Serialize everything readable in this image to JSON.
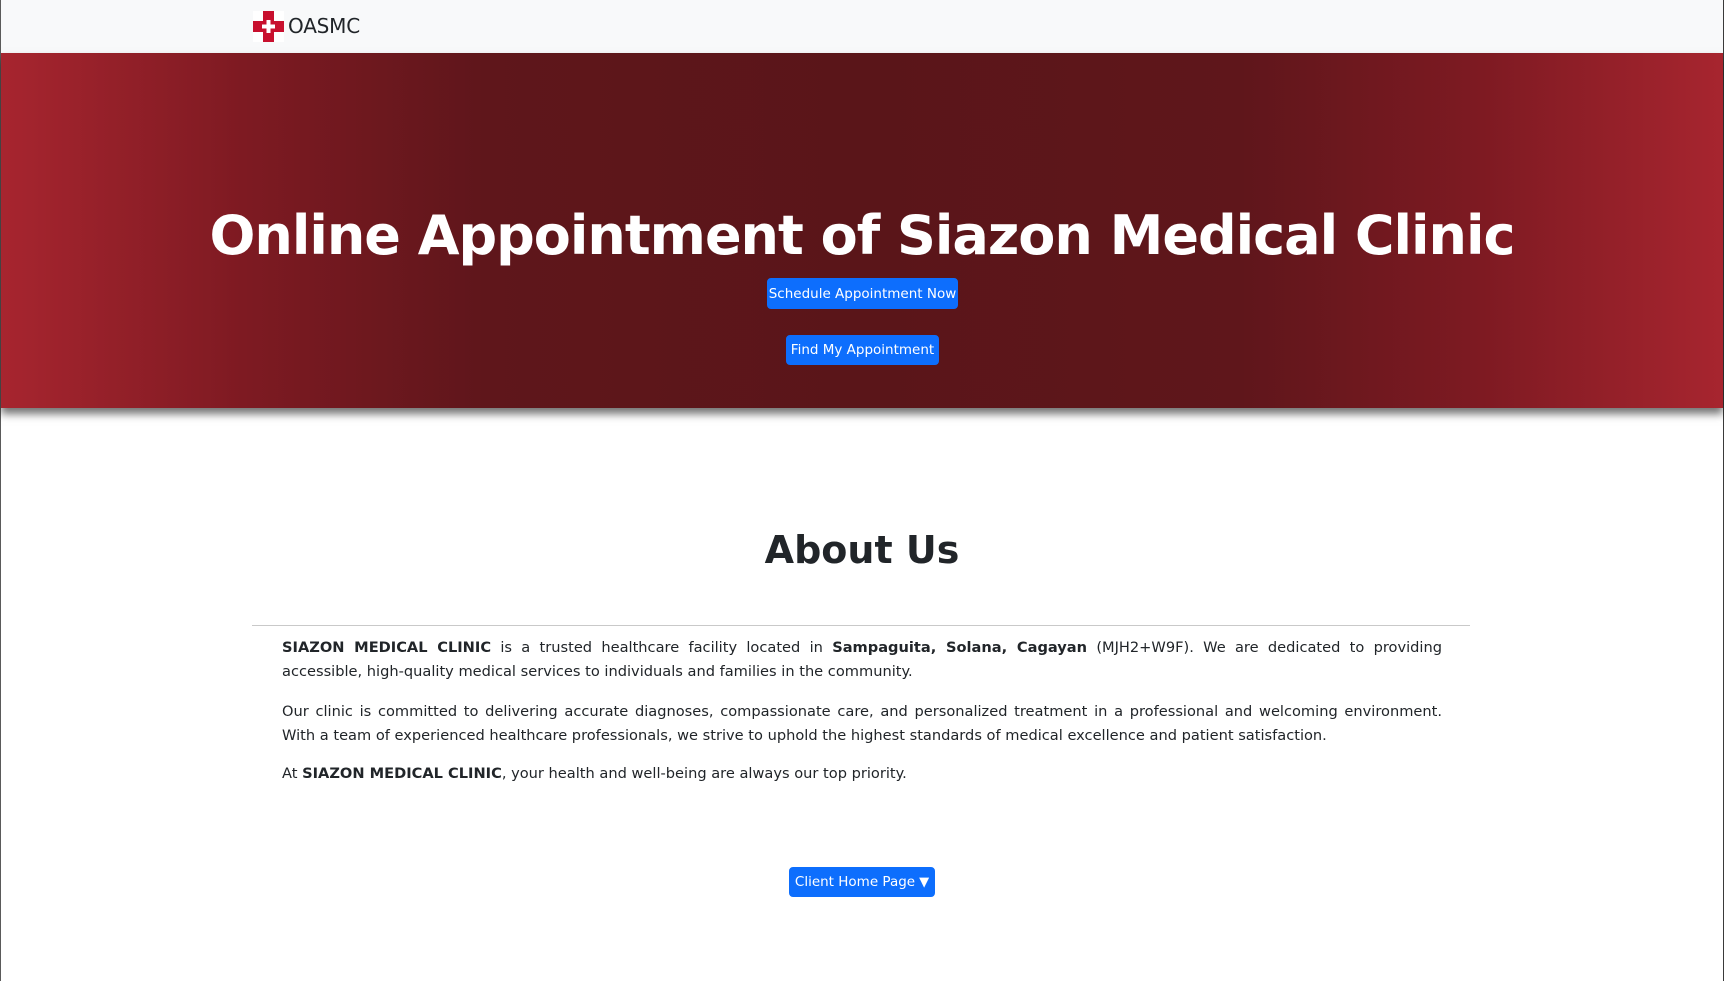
{
  "navbar": {
    "brand_name": "OASMC",
    "brand_icon": "red-cross-icon",
    "brand_color": "#c8102e"
  },
  "hero": {
    "title": "Online Appointment of Siazon Medical Clinic",
    "schedule_button": "Schedule Appointment Now",
    "find_button": "Find My Appointment",
    "gradient_center": "#5a1519",
    "gradient_edge": "#a7252f"
  },
  "about": {
    "heading": "About Us",
    "p1": {
      "clinic_name": "SIAZON MEDICAL CLINIC",
      "text1": " is a trusted healthcare facility located in ",
      "location": "Sampaguita, Solana, Cagayan",
      "text2": " (MJH2+W9F). We are dedicated to providing accessible, high-quality medical services to individuals and families in the community."
    },
    "p2": "Our clinic is committed to delivering accurate diagnoses, compassionate care, and personalized treatment in a professional and welcoming environment. With a team of experienced healthcare professionals, we strive to uphold the highest standards of medical excellence and patient satisfaction.",
    "p3": {
      "prefix": "At ",
      "clinic_name": "SIAZON MEDICAL CLINIC",
      "suffix": ", your health and well-being are always our top priority."
    }
  },
  "footer_button": {
    "label": "Client Home Page",
    "caret": "▼",
    "icon": "caret-down-icon"
  },
  "colors": {
    "primary_button": "#0d6efd",
    "navbar_bg": "#f8f9fa"
  }
}
